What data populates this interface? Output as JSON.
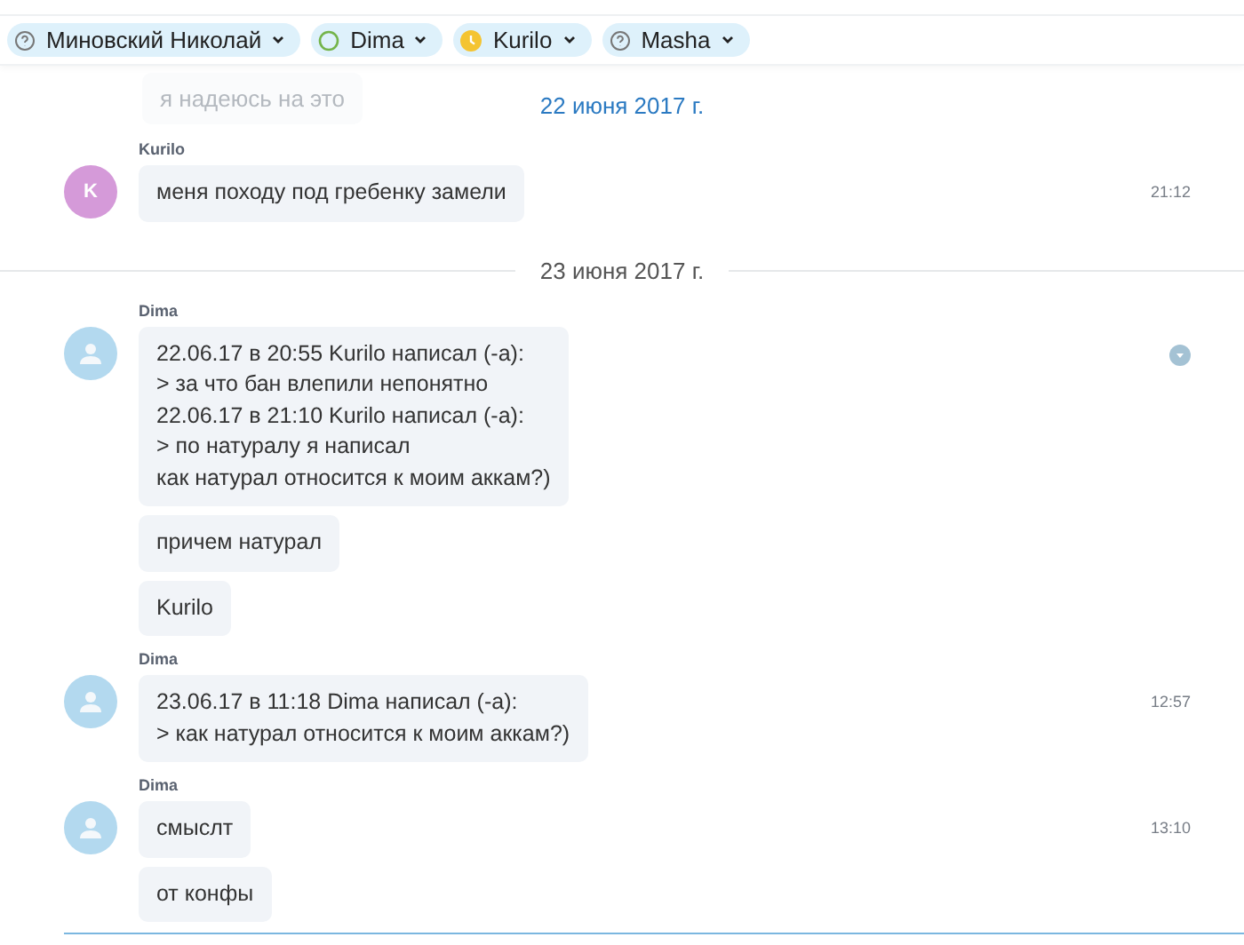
{
  "participants": [
    {
      "name": "Миновский Николай",
      "kind": "unknown"
    },
    {
      "name": "Dima",
      "kind": "online"
    },
    {
      "name": "Kurilo",
      "kind": "away"
    },
    {
      "name": "Masha",
      "kind": "unknown"
    }
  ],
  "faded_message": "я надеюсь на это",
  "sections": [
    {
      "date": "22 июня 2017 г.",
      "floating": true,
      "groups": [
        {
          "author": "Kurilo",
          "avatar": {
            "kind": "initial",
            "text": "K",
            "color": "#d59ad9"
          },
          "time": "21:12",
          "hovered": false,
          "messages": [
            "меня походу под гребенку замели"
          ]
        }
      ]
    },
    {
      "date": "23 июня 2017 г.",
      "floating": false,
      "groups": [
        {
          "author": "Dima",
          "avatar": {
            "kind": "silhouette"
          },
          "hovered": true,
          "messages": [
            "22.06.17 в 20:55 Kurilo написал (-а):\n> за что бан влепили непонятно\n22.06.17 в 21:10 Kurilo написал (-а):\n> по натуралу я написал\nкак натурал относится к моим аккам?)",
            "причем натурал",
            "Kurilo"
          ]
        },
        {
          "author": "Dima",
          "avatar": {
            "kind": "silhouette"
          },
          "time": "12:57",
          "hovered": false,
          "messages": [
            "23.06.17 в 11:18 Dima написал (-а):\n> как натурал относится к моим аккам?)"
          ]
        },
        {
          "author": "Dima",
          "avatar": {
            "kind": "silhouette"
          },
          "time": "13:10",
          "hovered": false,
          "messages": [
            "смыслт",
            "от конфы"
          ]
        }
      ]
    }
  ]
}
